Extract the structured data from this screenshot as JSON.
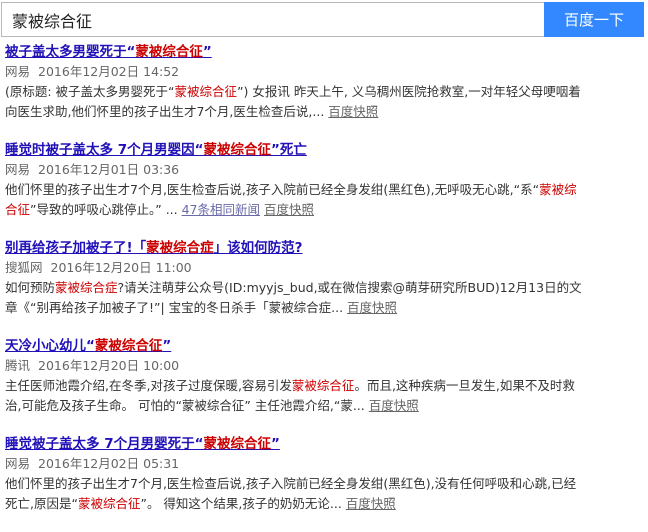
{
  "search": {
    "query": "蒙被综合征",
    "button_label": "百度一下"
  },
  "results": [
    {
      "title_pre": "被子盖太多男婴死于“",
      "title_hl": "蒙被综合征",
      "title_post": "”",
      "source": "网易",
      "date": "2016年12月02日 14:52",
      "snippet_a": "(原标题: 被子盖太多男婴死于“",
      "snippet_hl": "蒙被综合征",
      "snippet_b": "”) 女报讯 昨天上午, 义乌稠州医院抢救室,一对年轻父母哽咽着向医生求助,他们怀里的孩子出生才7个月,医生检查后说,... ",
      "more": "",
      "cache": "百度快照"
    },
    {
      "title_pre": "睡觉时被子盖太多 7个月男婴因“",
      "title_hl": "蒙被综合征",
      "title_post": "”死亡",
      "source": "网易",
      "date": "2016年12月01日 03:36",
      "snippet_a": "他们怀里的孩子出生才7个月,医生检查后说,孩子入院前已经全身发绀(黑红色),无呼吸无心跳,“系“",
      "snippet_hl": "蒙被综合征",
      "snippet_b": "”导致的呼吸心跳停止。” ... ",
      "more": "47条相同新闻",
      "cache": "百度快照"
    },
    {
      "title_pre": "别再给孩子加被子了!「",
      "title_hl": "蒙被综合症",
      "title_post": "」该如何防范?",
      "source": "搜狐网",
      "date": "2016年12月20日 11:00",
      "snippet_a": "如何预防",
      "snippet_hl": "蒙被综合症",
      "snippet_b": "?请关注萌芽公众号(ID:myyjs_bud,或在微信搜索@萌芽研究所BUD)12月13日的文章《“别再给孩子加被子了!”| 宝宝的冬日杀手「蒙被综合症... ",
      "more": "",
      "cache": "百度快照"
    },
    {
      "title_pre": "天冷小心幼儿“",
      "title_hl": "蒙被综合征",
      "title_post": "”",
      "source": "腾讯",
      "date": "2016年12月20日 10:00",
      "snippet_a": "主任医师池霞介绍,在冬季,对孩子过度保暖,容易引发",
      "snippet_hl": "蒙被综合征",
      "snippet_b": "。而且,这种疾病一旦发生,如果不及时救治,可能危及孩子生命。 可怕的“蒙被综合征” 主任池霞介绍,“蒙... ",
      "more": "",
      "cache": "百度快照"
    },
    {
      "title_pre": "睡觉被子盖太多 7个月男婴死于“",
      "title_hl": "蒙被综合征",
      "title_post": "”",
      "source": "网易",
      "date": "2016年12月02日 05:31",
      "snippet_a": "他们怀里的孩子出生才7个月,医生检查后说,孩子入院前已经全身发绀(黑红色),没有任何呼吸和心跳,已经死亡,原因是“",
      "snippet_hl": "蒙被综合征",
      "snippet_b": "”。 得知这个结果,孩子的奶奶无论... ",
      "more": "",
      "cache": "百度快照"
    }
  ]
}
